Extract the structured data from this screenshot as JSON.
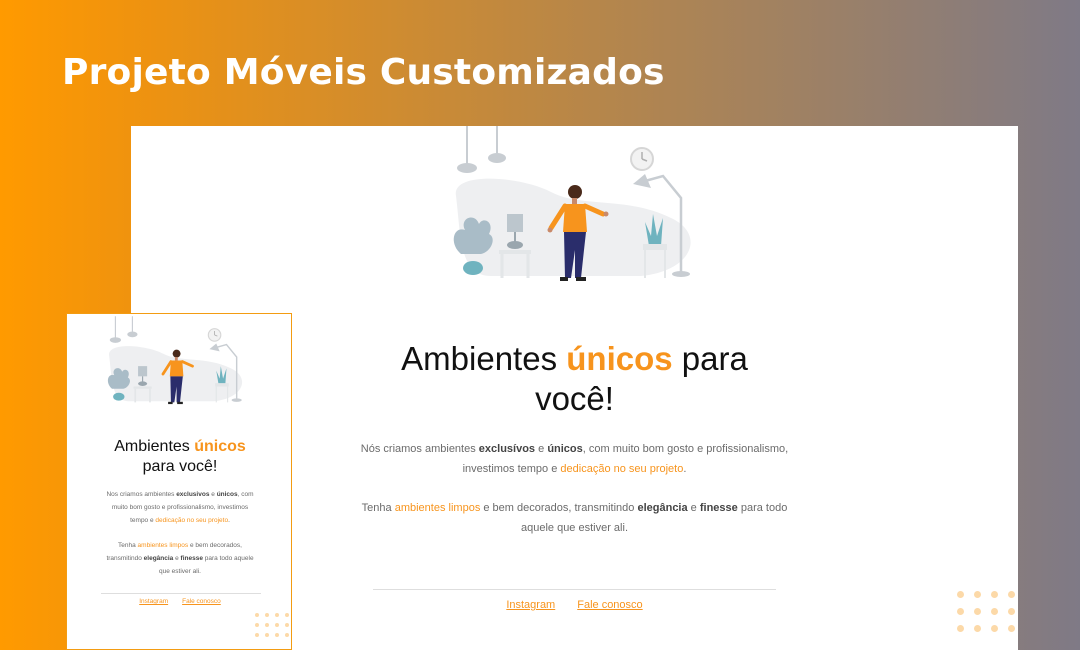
{
  "headline": "Projeto Móveis Customizados",
  "colors": {
    "accent": "#f7941d",
    "shirt": "#f7941d",
    "pants": "#2a2d6b",
    "plant": "#9fb8c5",
    "pot": "#6fb3bf"
  },
  "desktop": {
    "title": {
      "pre": "Ambientes",
      "accent": "únicos",
      "post_line1": "para",
      "line2": "você!"
    },
    "p1": {
      "t1": "Nós criamos ambientes",
      "b1": "exclusívos",
      "t2": "e",
      "b2": "únicos",
      "t3": ", com muito bom gosto e profissionalismo,",
      "t4": "investimos tempo e",
      "hl1": "dedicação no seu projeto",
      "t5": "."
    },
    "p2": {
      "t1": "Tenha",
      "hl1": "ambientes limpos",
      "t2": "e bem decorados, transmitindo",
      "b1": "elegância",
      "t3": "e",
      "b2": "finesse",
      "t4": "para todo",
      "t5": "aquele que estiver ali."
    },
    "links": {
      "instagram": "Instagram",
      "contact": "Fale conosco"
    }
  },
  "mobile": {
    "title": {
      "pre": "Ambientes",
      "accent": "únicos",
      "line2": "para você!"
    },
    "p1": {
      "t1": "Nos criamos ambientes",
      "b1": "exclusivos",
      "t2": "e",
      "b2": "únicos",
      "t3": ", com",
      "t4": "muito bom gosto e profissionalismo, investimos",
      "t5": "tempo e",
      "hl1": "dedicação no seu projeto",
      "t6": "."
    },
    "p2": {
      "t1": "Tenha",
      "hl1": "ambientes limpos",
      "t2": "e bem decorados,",
      "t3": "transmitindo",
      "b1": "elegância",
      "t4": "e",
      "b2": "finesse",
      "t5": "para todo aquele",
      "t6": "que estiver ali."
    },
    "links": {
      "instagram": "Instagram",
      "contact": "Fale conosco"
    }
  }
}
